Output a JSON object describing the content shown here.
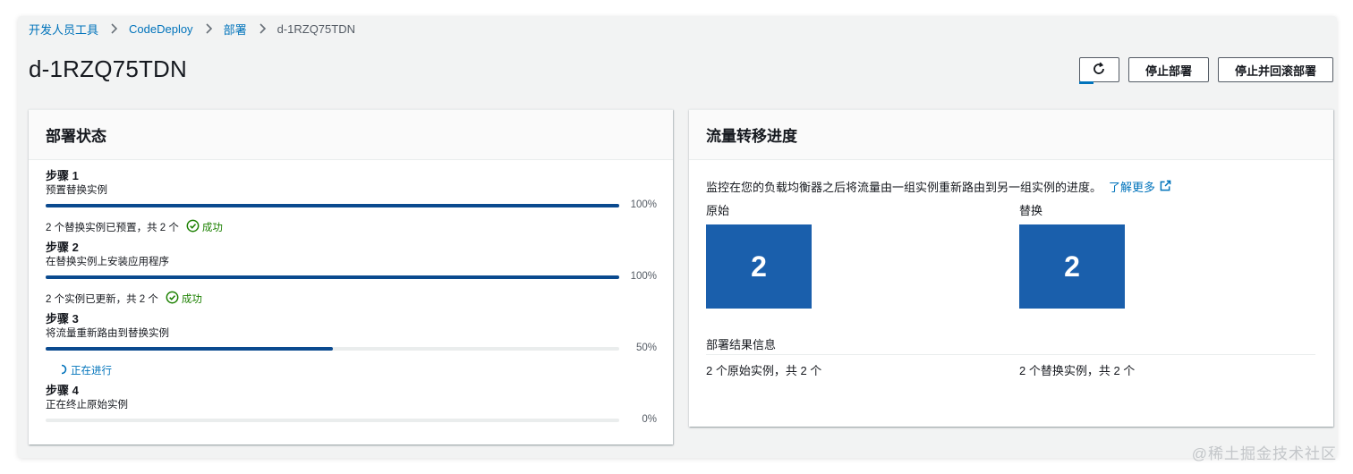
{
  "breadcrumb": {
    "items": [
      "开发人员工具",
      "CodeDeploy",
      "部署"
    ],
    "current": "d-1RZQ75TDN"
  },
  "page": {
    "title": "d-1RZQ75TDN"
  },
  "actions": {
    "refresh_icon": "refresh-icon",
    "stop": "停止部署",
    "stop_rollback": "停止并回滚部署"
  },
  "deployment_status": {
    "title": "部署状态",
    "steps": [
      {
        "label": "步骤 1",
        "description": "预置替换实例",
        "progress": 100,
        "percent_text": "100%",
        "status_text": "2 个替换实例已预置，共 2 个",
        "status": "成功",
        "status_type": "success"
      },
      {
        "label": "步骤 2",
        "description": "在替换实例上安装应用程序",
        "progress": 100,
        "percent_text": "100%",
        "status_text": "2 个实例已更新，共 2 个",
        "status": "成功",
        "status_type": "success"
      },
      {
        "label": "步骤 3",
        "description": "将流量重新路由到替换实例",
        "progress": 50,
        "percent_text": "50%",
        "status_text": "",
        "status": "正在进行",
        "status_type": "in-progress"
      },
      {
        "label": "步骤 4",
        "description": "正在终止原始实例",
        "progress": 0,
        "percent_text": "0%",
        "status_text": "",
        "status": "",
        "status_type": "none"
      }
    ]
  },
  "traffic": {
    "title": "流量转移进度",
    "description": "监控在您的负载均衡器之后将流量由一组实例重新路由到另一组实例的进度。",
    "learn_more": "了解更多",
    "original_label": "原始",
    "original_count": "2",
    "replacement_label": "替换",
    "replacement_count": "2",
    "result_title": "部署结果信息",
    "original_result": "2 个原始实例，共 2 个",
    "replacement_result": "2 个替换实例，共 2 个"
  },
  "watermark": "@稀土掘金技术社区",
  "colors": {
    "link": "#0073bb",
    "progress": "#0a4a8f",
    "success": "#1d8102",
    "count_box": "#1a5fac"
  }
}
